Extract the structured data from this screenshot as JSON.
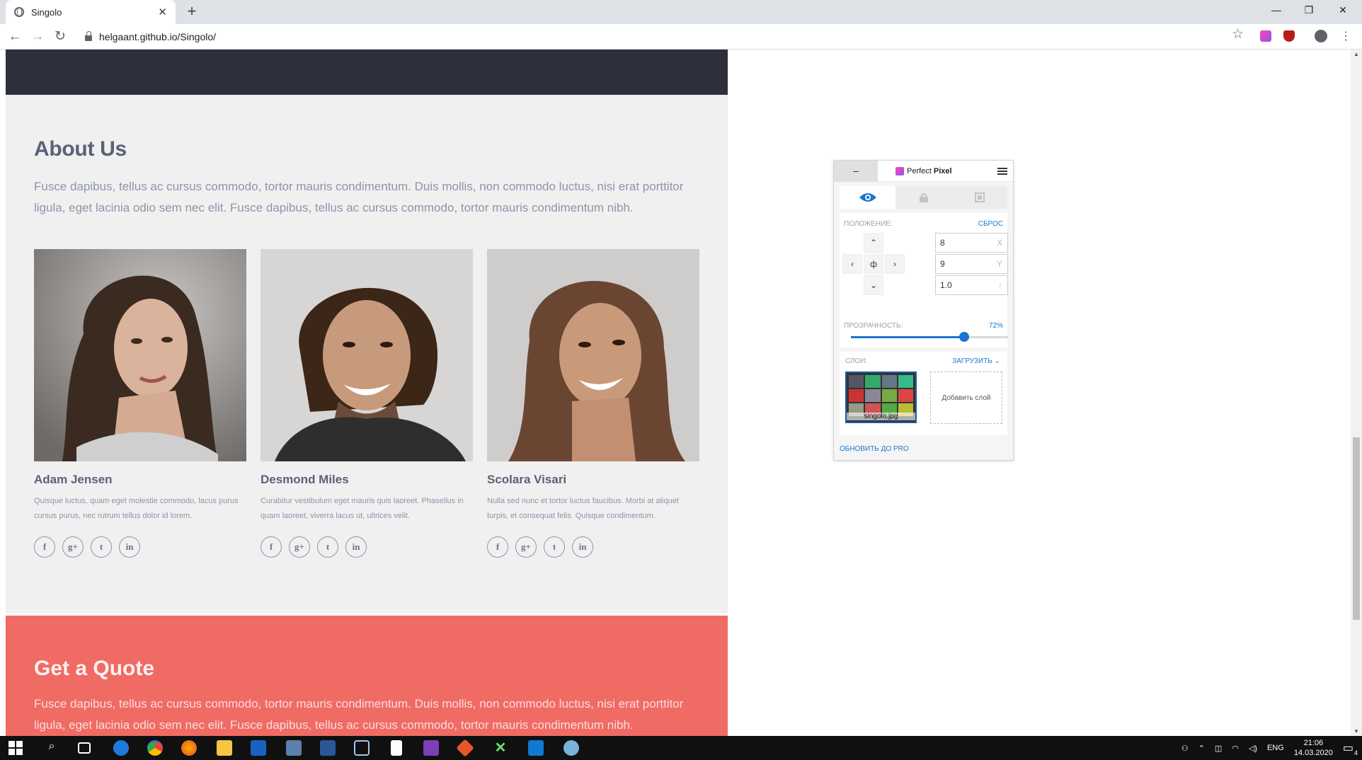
{
  "browser": {
    "tab_title": "Singolo",
    "tab_close": "✕",
    "new_tab": "+",
    "url": "helgaant.github.io/Singolo/",
    "window_controls": [
      "—",
      "❐",
      "✕"
    ],
    "nav": {
      "back": "←",
      "forward": "→",
      "reload": "↻"
    }
  },
  "about": {
    "title": "About Us",
    "intro": "Fusce dapibus, tellus ac cursus commodo, tortor mauris condimentum. Duis mollis, non commodo luctus, nisi erat porttitor ligula, eget lacinia odio sem nec elit. Fusce dapibus, tellus ac cursus commodo, tortor mauris condimentum nibh.",
    "members": [
      {
        "name": "Adam Jensen",
        "bio": "Quisque luctus, quam eget molestie commodo, lacus purus cursus purus, nec rutrum tellus dolor id lorem.",
        "socials": [
          "f",
          "g+",
          "t",
          "in"
        ]
      },
      {
        "name": "Desmond Miles",
        "bio": "Curabitur vestibulum eget mauris quis laoreet. Phasellus in quam laoreet, viverra lacus ut, ultrices velit.",
        "socials": [
          "f",
          "g+",
          "t",
          "in"
        ]
      },
      {
        "name": "Scolara Visari",
        "bio": "Nulla sed nunc et tortor luctus faucibus. Morbi at aliquet turpis, et consequat felis. Quisque condimentum.",
        "socials": [
          "f",
          "g+",
          "t",
          "in"
        ]
      }
    ]
  },
  "quote": {
    "title": "Get a Quote",
    "text": "Fusce dapibus, tellus ac cursus commodo, tortor mauris condimentum. Duis mollis, non commodo luctus, nisi erat porttitor ligula, eget lacinia odio sem nec elit. Fusce dapibus, tellus ac cursus commodo, tortor mauris condimentum nibh."
  },
  "perfect_pixel": {
    "title_prefix": "Perfect ",
    "title_bold": "Pixel",
    "minimize": "–",
    "position_label": "ПОЛОЖЕНИЕ:",
    "reset_label": "СБРОС",
    "x_value": "8",
    "y_value": "9",
    "scale_value": "1.0",
    "x_axis": "X",
    "y_axis": "Y",
    "scale_axis": "↑",
    "opacity_label": "ПРОЗРАЧНОСТЬ:",
    "opacity_value": "72%",
    "opacity_fraction": 0.72,
    "layers_label": "СЛОИ:",
    "upload_label": "ЗАГРУЗИТЬ",
    "layer_name": "singolo.jpg",
    "add_layer": "Добавить слой",
    "upgrade": "ОБНОВИТЬ ДО PRO"
  },
  "taskbar": {
    "lang": "ENG",
    "time": "21:06",
    "date": "14.03.2020",
    "notifications": "4"
  },
  "colors": {
    "dark_band": "#2d303a",
    "about_bg": "#f0f0f0",
    "quote_bg": "#ef6b64",
    "accent": "#1976d2"
  }
}
